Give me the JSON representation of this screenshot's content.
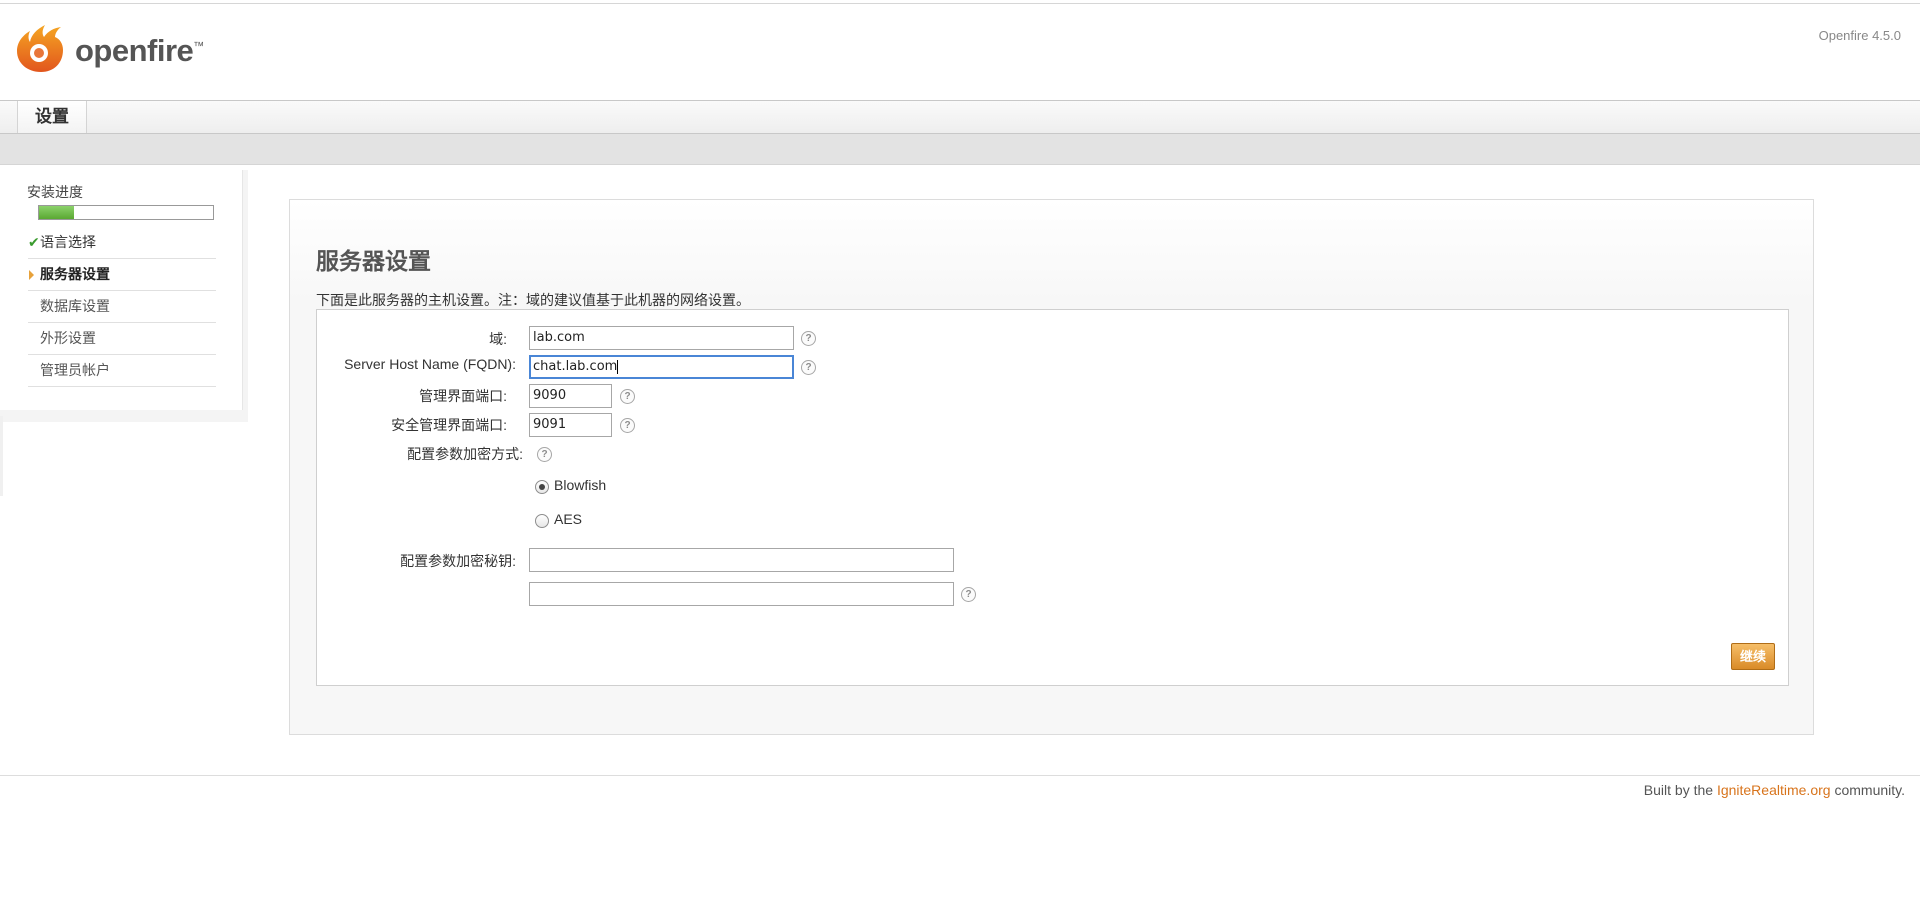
{
  "header": {
    "logo_text": "openfire",
    "logo_tm": "™",
    "version": "Openfire 4.5.0"
  },
  "tabs": [
    {
      "label": "设置",
      "active": true
    }
  ],
  "sidebar": {
    "title": "安装进度",
    "progress_fraction": 0.2,
    "steps": [
      {
        "label": "语言选择",
        "status": "done"
      },
      {
        "label": "服务器设置",
        "status": "current"
      },
      {
        "label": "数据库设置",
        "status": "pending"
      },
      {
        "label": "外形设置",
        "status": "pending"
      },
      {
        "label": "管理员帐户",
        "status": "pending"
      }
    ]
  },
  "main": {
    "title": "服务器设置",
    "intro": "下面是此服务器的主机设置。注：域的建议值基于此机器的网络设置。",
    "fields": {
      "domain": {
        "label": "域:",
        "value": "lab.com"
      },
      "fqdn": {
        "label": "Server Host Name (FQDN):",
        "value": "chat.lab.com"
      },
      "admin_port": {
        "label": "管理界面端口:",
        "value": "9090"
      },
      "secure_admin_port": {
        "label": "安全管理界面端口:",
        "value": "9091"
      },
      "encryption": {
        "label": "配置参数加密方式:",
        "options": [
          {
            "label": "Blowfish",
            "selected": true
          },
          {
            "label": "AES",
            "selected": false
          }
        ]
      },
      "encryption_key": {
        "label": "配置参数加密秘钥:",
        "value": "",
        "confirm_value": ""
      }
    },
    "continue_label": "继续"
  },
  "footer": {
    "prefix": "Built by the ",
    "link": "IgniteRealtime.org",
    "suffix": " community."
  },
  "colors": {
    "accent_orange": "#d8741c",
    "progress_green": "#5aa832",
    "focus_blue": "#4a86d6"
  },
  "icons": {
    "help": "question-circle-icon",
    "done": "checkmark-icon",
    "current": "triangle-right-icon"
  }
}
